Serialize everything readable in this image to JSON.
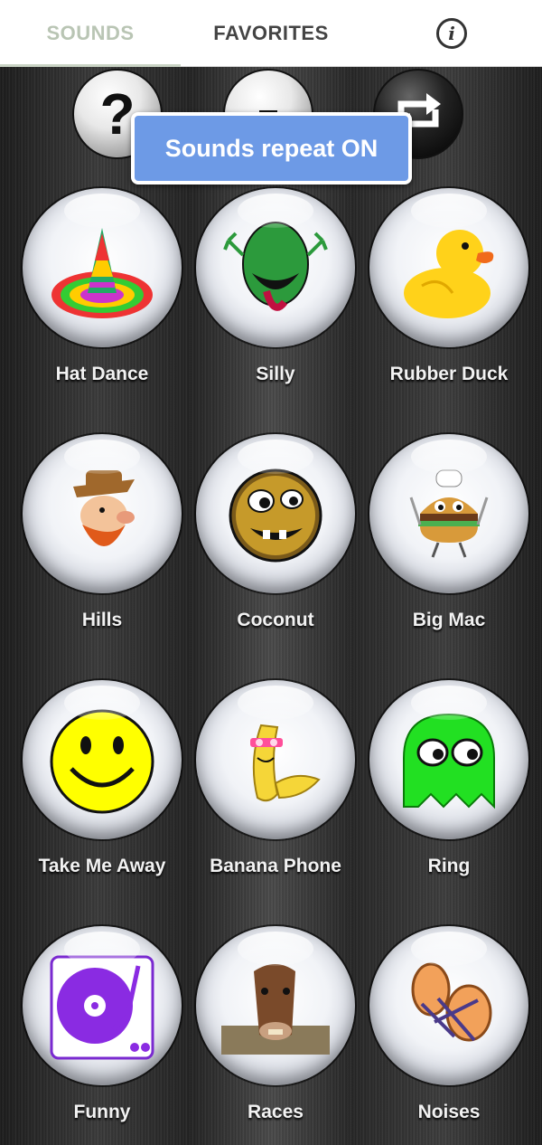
{
  "tabs": {
    "sounds": "SOUNDS",
    "favorites": "FAVORITES",
    "info_symbol": "i"
  },
  "top_buttons": {
    "help_symbol": "?",
    "middle_icon": "minus-icon",
    "repeat_icon": "repeat-icon"
  },
  "toast": {
    "text": "Sounds repeat ON"
  },
  "sounds": [
    {
      "label": "Hat Dance",
      "icon": "sombrero-icon"
    },
    {
      "label": "Silly",
      "icon": "green-monster-icon"
    },
    {
      "label": "Rubber Duck",
      "icon": "rubber-duck-icon"
    },
    {
      "label": "Hills",
      "icon": "hillbilly-icon"
    },
    {
      "label": "Coconut",
      "icon": "coconut-face-icon"
    },
    {
      "label": "Big Mac",
      "icon": "burger-chef-icon"
    },
    {
      "label": "Take Me Away",
      "icon": "smiley-face-icon"
    },
    {
      "label": "Banana Phone",
      "icon": "banana-icon"
    },
    {
      "label": "Ring",
      "icon": "green-ghost-icon"
    },
    {
      "label": "Funny",
      "icon": "turntable-icon"
    },
    {
      "label": "Races",
      "icon": "horse-icon"
    },
    {
      "label": "Noises",
      "icon": "drum-icon"
    }
  ],
  "colors": {
    "toast_bg": "#6d9ae6",
    "active_tab": "#b9c5b4",
    "tab_text": "#444444"
  }
}
